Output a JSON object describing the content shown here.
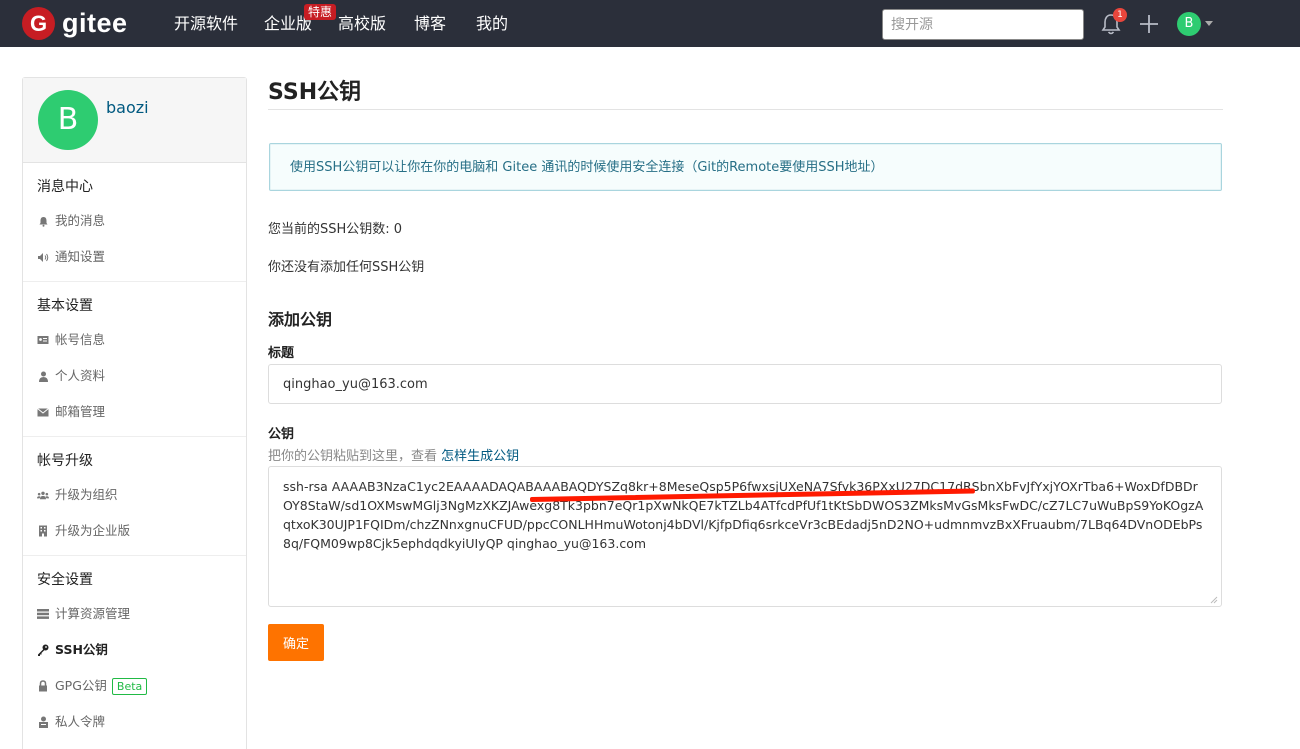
{
  "topbar": {
    "logo_letter": "G",
    "logo_text": "gitee",
    "nav": [
      "开源软件",
      "企业版",
      "高校版",
      "博客",
      "我的"
    ],
    "enterprise_badge": "特惠",
    "search_placeholder": "搜开源",
    "notification_count": "1",
    "avatar_letter": "B"
  },
  "sidebar": {
    "avatar_letter": "B",
    "username": "baozi",
    "groups": [
      {
        "title": "消息中心",
        "items": [
          {
            "label": "我的消息",
            "icon": "bell-icon"
          },
          {
            "label": "通知设置",
            "icon": "speaker-icon"
          }
        ]
      },
      {
        "title": "基本设置",
        "items": [
          {
            "label": "帐号信息",
            "icon": "id-card-icon"
          },
          {
            "label": "个人资料",
            "icon": "user-icon"
          },
          {
            "label": "邮箱管理",
            "icon": "mail-icon"
          }
        ]
      },
      {
        "title": "帐号升级",
        "items": [
          {
            "label": "升级为组织",
            "icon": "users-icon"
          },
          {
            "label": "升级为企业版",
            "icon": "building-icon"
          }
        ]
      },
      {
        "title": "安全设置",
        "items": [
          {
            "label": "计算资源管理",
            "icon": "server-icon"
          },
          {
            "label": "SSH公钥",
            "icon": "key-icon",
            "active": true
          },
          {
            "label": "GPG公钥",
            "icon": "lock-icon",
            "badge": "Beta"
          },
          {
            "label": "私人令牌",
            "icon": "token-icon"
          }
        ]
      }
    ]
  },
  "main": {
    "title": "SSH公钥",
    "info": "使用SSH公钥可以让你在你的电脑和 Gitee 通讯的时候使用安全连接（Git的Remote要使用SSH地址）",
    "count_line": "您当前的SSH公钥数: 0",
    "empty_line": "你还没有添加任何SSH公钥",
    "add_heading": "添加公钥",
    "title_label": "标题",
    "title_value": "qinghao_yu@163.com",
    "key_label": "公钥",
    "key_hint": "把你的公钥粘贴到这里，查看",
    "key_hint_link": "怎样生成公钥",
    "key_value": "ssh-rsa AAAAB3NzaC1yc2EAAAADAQABAAABAQDYSZq8kr+8MeseQsp5P6fwxsjUXeNA7Sfyk36PXxU27DC17dRSbnXbFvJfYxjYOXrTba6+WoxDfDBDrOY8StaW/sd1OXMswMGlj3NgMzXKZJAwexg8Tk3pbn7eQr1pXwNkQE7kTZLb4ATfcdPfUf1tKtSbDWOS3ZMksMvGsMksFwDC/cZ7LC7uWuBpS9YoKOgzAqtxoK30UJP1FQIDm/chzZNnxgnuCFUD/ppcCONLHHmuWotonj4bDVl/KjfpDfiq6srkceVr3cBEdadj5nD2NO+udmnmvzBxXFruaubm/7LBq64DVnODEbPs8q/FQM09wp8Cjk5ephdqdkyiUIyQP qinghao_yu@163.com",
    "submit": "确定"
  }
}
